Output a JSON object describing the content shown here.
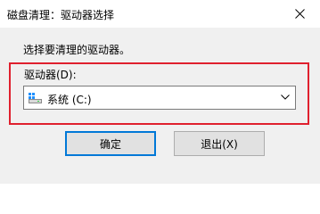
{
  "window": {
    "title": "磁盘清理：驱动器选择",
    "close_icon": "close-icon"
  },
  "content": {
    "prompt": "选择要清理的驱动器。",
    "drive_label": "驱动器(D):",
    "drive_select": {
      "value": "系统 (C:)",
      "icon": "drive-icon"
    }
  },
  "buttons": {
    "ok_label": "确定",
    "exit_label": "退出(X)"
  },
  "colors": {
    "highlight": "#e0202e",
    "default_button_border": "#0078d7"
  }
}
